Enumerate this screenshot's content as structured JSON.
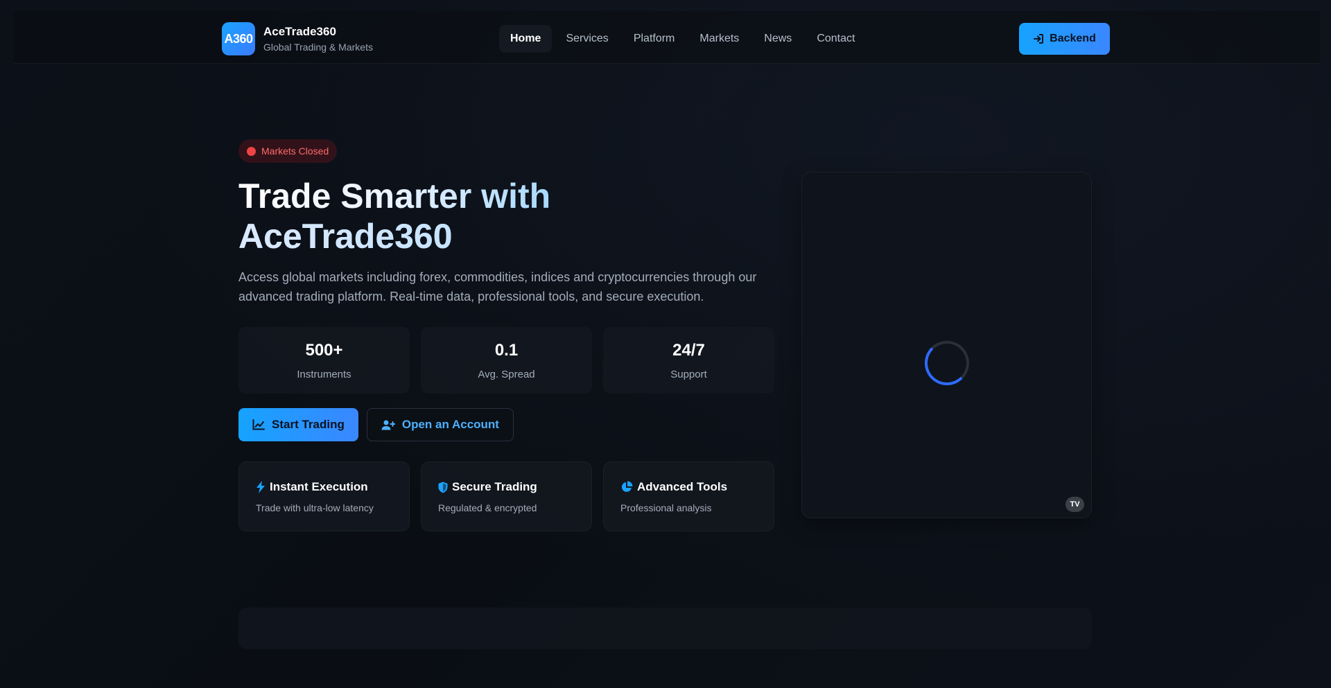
{
  "brand": {
    "logo_text": "A360",
    "name": "AceTrade360",
    "tagline": "Global Trading & Markets"
  },
  "nav": {
    "items": [
      {
        "label": "Home",
        "active": true
      },
      {
        "label": "Services"
      },
      {
        "label": "Platform"
      },
      {
        "label": "Markets"
      },
      {
        "label": "News"
      },
      {
        "label": "Contact"
      }
    ],
    "backend_label": "Backend"
  },
  "hero": {
    "status_badge": "Markets Closed",
    "title_line1": "Trade Smarter with",
    "title_line2": "AceTrade360",
    "description": "Access global markets including forex, commodities, indices and cryptocurrencies through our advanced trading platform. Real-time data, professional tools, and secure execution.",
    "stats": [
      {
        "value": "500+",
        "label": "Instruments"
      },
      {
        "value": "0.1",
        "label": "Avg. Spread"
      },
      {
        "value": "24/7",
        "label": "Support"
      }
    ],
    "cta_primary": "Start Trading",
    "cta_secondary": "Open an Account",
    "features": [
      {
        "icon": "bolt-icon",
        "title": "Instant Execution",
        "desc": "Trade with ultra-low latency"
      },
      {
        "icon": "shield-icon",
        "title": "Secure Trading",
        "desc": "Regulated & encrypted"
      },
      {
        "icon": "pie-chart-icon",
        "title": "Advanced Tools",
        "desc": "Professional analysis"
      }
    ]
  },
  "chart_widget": {
    "badge": "TV"
  },
  "colors": {
    "accent": "#1aa3ff",
    "accent2": "#3a87ff",
    "status_red": "#ef4444",
    "bg": "#0b0f16"
  }
}
